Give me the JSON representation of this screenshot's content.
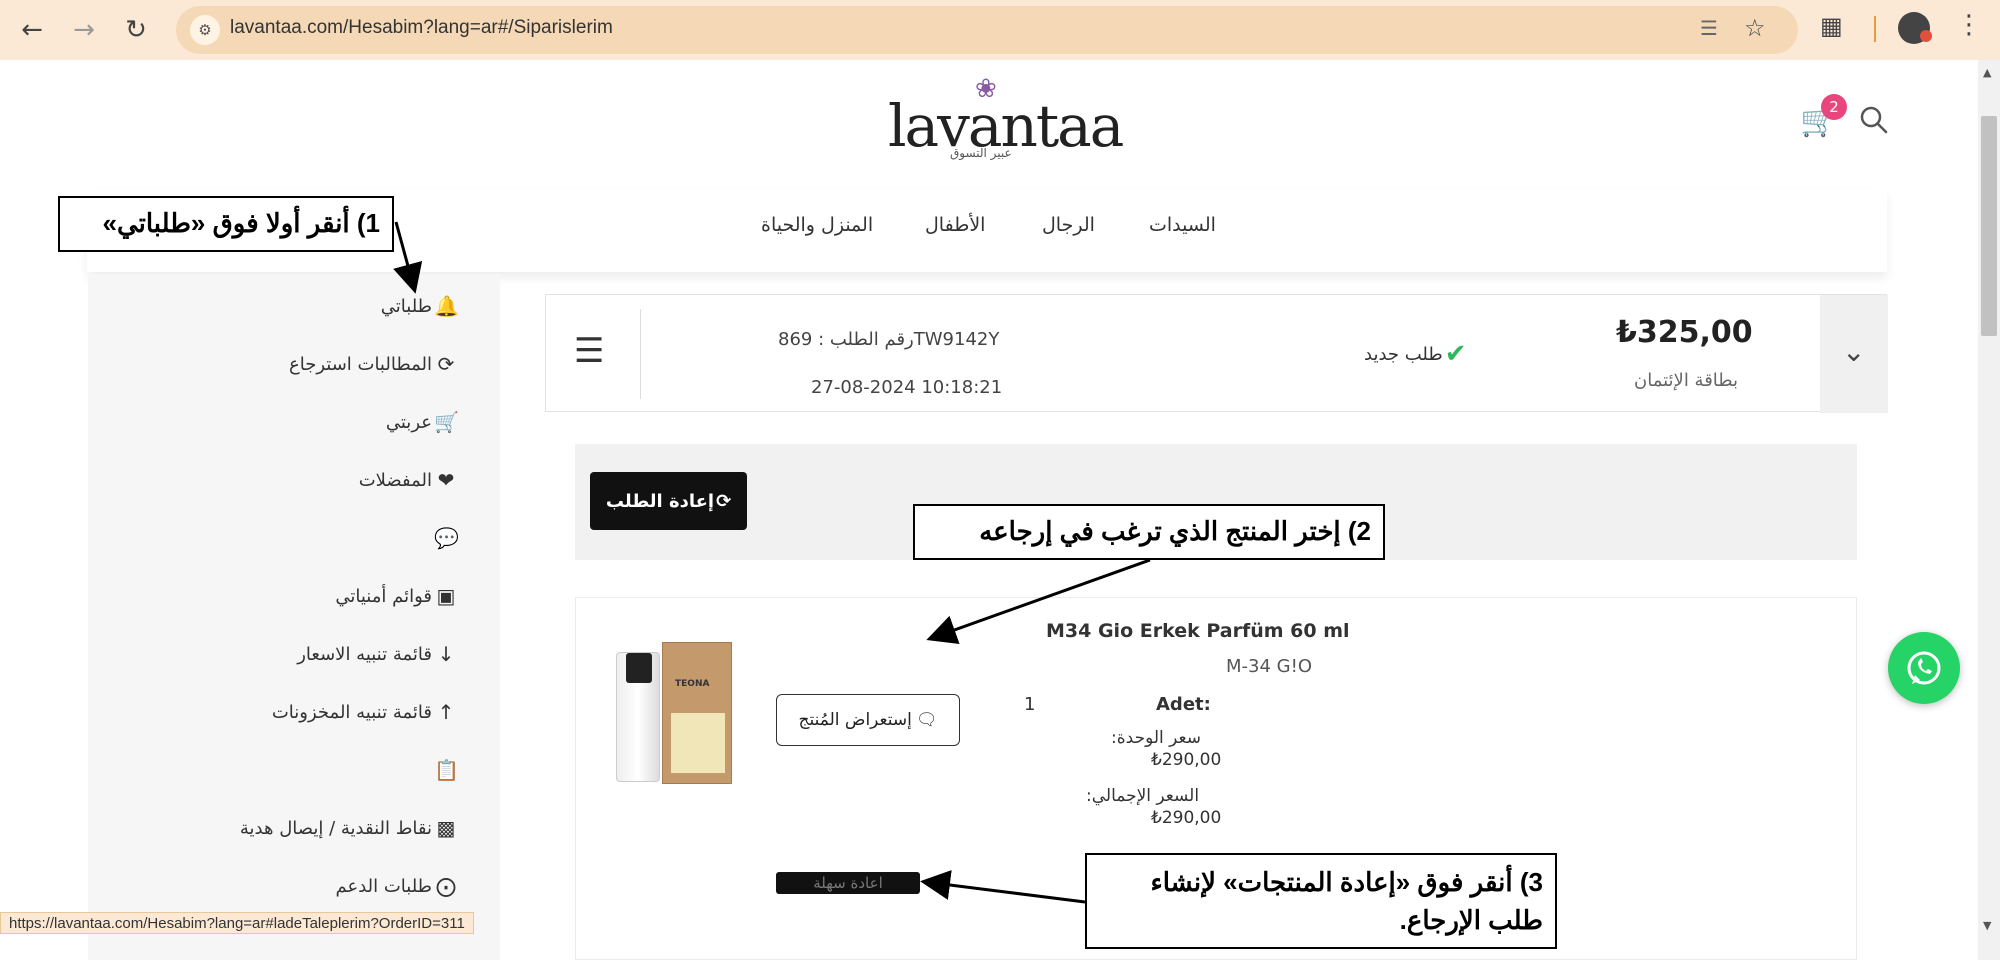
{
  "browser": {
    "url": "lavantaa.com/Hesabim?lang=ar#/Siparislerim",
    "status_url": "https://lavantaa.com/Hesabim?lang=ar#ladeTaleplerim?OrderID=311"
  },
  "header": {
    "logo_text": "lavantaa",
    "logo_tagline": "عبير التسوق",
    "cart_count": "2"
  },
  "categories": [
    "السيدات",
    "الرجال",
    "الأطفال",
    "المنزل والحياة"
  ],
  "sidebar": {
    "items": [
      {
        "icon": "bell-icon",
        "label": "طلباتي"
      },
      {
        "icon": "refresh-icon",
        "label": "المطالبات استرجاع"
      },
      {
        "icon": "cart-icon",
        "label": "عربتي"
      },
      {
        "icon": "heart-icon",
        "label": "المفضلات"
      },
      {
        "icon": "comments-icon",
        "label": ""
      },
      {
        "icon": "box-icon",
        "label": "قوائم أمنياتي"
      },
      {
        "icon": "arrow-down-icon",
        "label": "قائمة تنبيه الاسعار"
      },
      {
        "icon": "arrow-up-icon",
        "label": "قائمة تنبيه المخزونات"
      },
      {
        "icon": "clipboard-icon",
        "label": ""
      },
      {
        "icon": "money-icon",
        "label": "نقاط النقدية / إيصال هدية"
      },
      {
        "icon": "support-icon",
        "label": "طلبات الدعم"
      }
    ]
  },
  "order": {
    "price": "₺325,00",
    "payment_method": "بطاقة الإئتمان",
    "status": "طلب جديد",
    "order_number": "رقم الطلب : 869TW9142Y",
    "date": "27-08-2024 10:18:21",
    "reorder_label": "إعادة الطلب"
  },
  "product": {
    "name": "M34 Gio Erkek Parfüm 60 ml",
    "code": "M-34 G!O",
    "brand": "TEONA",
    "review_label": "إستعراض المُنتج",
    "qty_label": "Adet:",
    "qty_value": "1",
    "unit_price_label": ":سعر الوحدة",
    "unit_price": "₺290,00",
    "total_price_label": ":السعر الإجمالي",
    "total_price": "₺290,00",
    "easy_return_label": "اعادة سهلة"
  },
  "callouts": {
    "step1": "1) أنقر أولا فوق «طلباتي»",
    "step2": "2) إختر المنتج الذي ترغب في إرجاعه",
    "step3_line1": "3) أنقر فوق «إعادة المنتجات» لإنشاء",
    "step3_line2": "طلب الإرجاع."
  },
  "colors": {
    "chrome_bg": "#fbe9d6",
    "badge": "#e8467c",
    "check": "#2eb85c",
    "whatsapp": "#25d366"
  }
}
